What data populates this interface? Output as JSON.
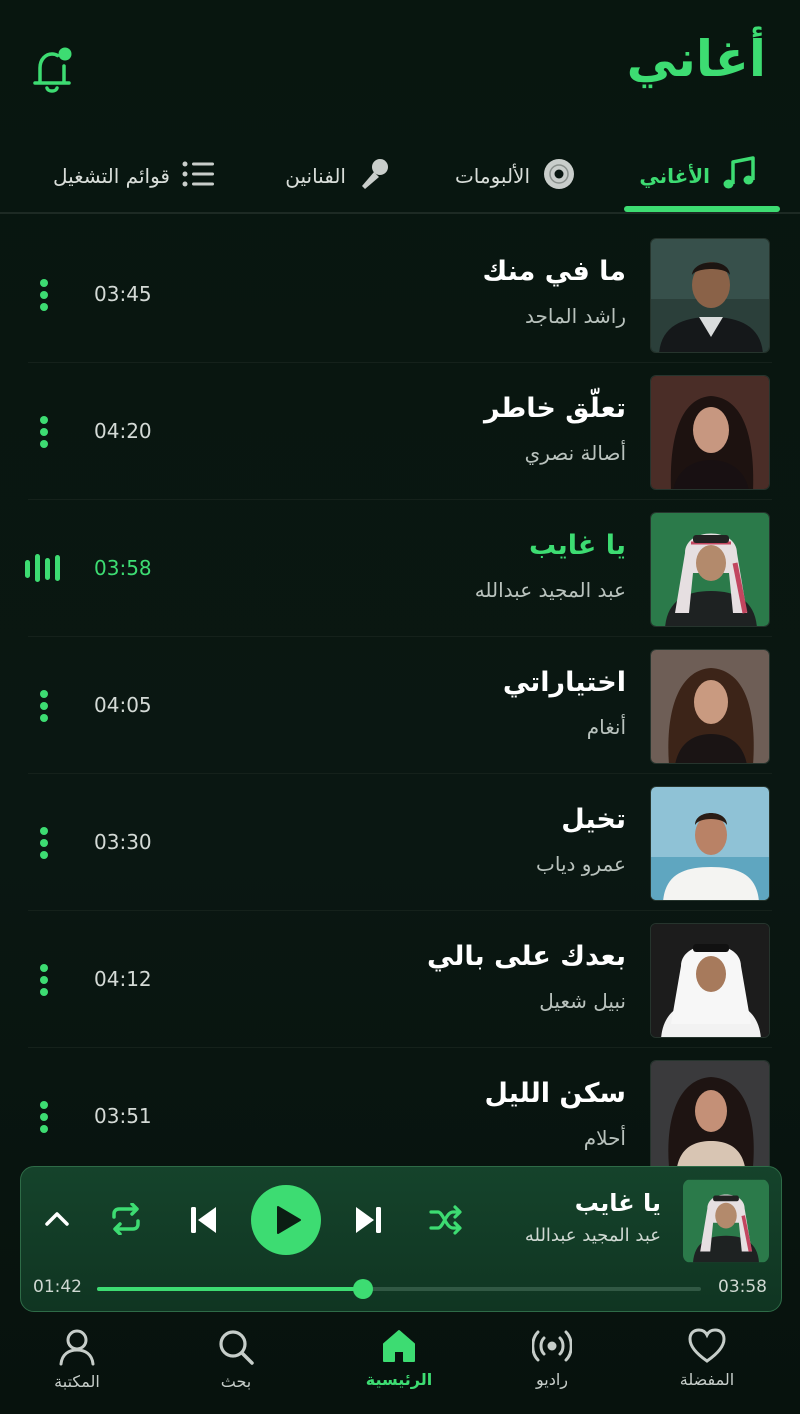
{
  "header": {
    "title": "أغاني",
    "notification_icon": "bell-icon"
  },
  "tabs": [
    {
      "label": "الأغاني",
      "icon": "music-note-icon",
      "active": true
    },
    {
      "label": "الألبومات",
      "icon": "disc-icon",
      "active": false
    },
    {
      "label": "الفنانين",
      "icon": "microphone-icon",
      "active": false
    },
    {
      "label": "قوائم التشغيل",
      "icon": "list-icon",
      "active": false
    }
  ],
  "songs": [
    {
      "title": "ما في منك",
      "artist": "راشد الماجد",
      "duration": "03:45",
      "playing": false
    },
    {
      "title": "تعلّق خاطر",
      "artist": "أصالة نصري",
      "duration": "04:20",
      "playing": false
    },
    {
      "title": "يا غايب",
      "artist": "عبد المجيد عبدالله",
      "duration": "03:58",
      "playing": true
    },
    {
      "title": "اختياراتي",
      "artist": "أنغام",
      "duration": "04:05",
      "playing": false
    },
    {
      "title": "تخيل",
      "artist": "عمرو دياب",
      "duration": "03:30",
      "playing": false
    },
    {
      "title": "بعدك على بالي",
      "artist": "نبيل شعيل",
      "duration": "04:12",
      "playing": false
    },
    {
      "title": "سكن الليل",
      "artist": "أحلام",
      "duration": "03:51",
      "playing": false
    }
  ],
  "player": {
    "title": "يا غايب",
    "artist": "عبد المجيد عبدالله",
    "elapsed": "01:42",
    "total": "03:58",
    "progress": 0.44
  },
  "bottom_nav": [
    {
      "label": "المفضلة",
      "icon": "heart-icon",
      "active": false
    },
    {
      "label": "راديو",
      "icon": "radio-icon",
      "active": false
    },
    {
      "label": "الرئيسية",
      "icon": "home-icon",
      "active": true
    },
    {
      "label": "بحث",
      "icon": "search-icon",
      "active": false
    },
    {
      "label": "المكتبة",
      "icon": "user-icon",
      "active": false
    }
  ],
  "colors": {
    "accent": "#3ddc72",
    "background": "#07140f",
    "player_bg": "#15432b"
  }
}
